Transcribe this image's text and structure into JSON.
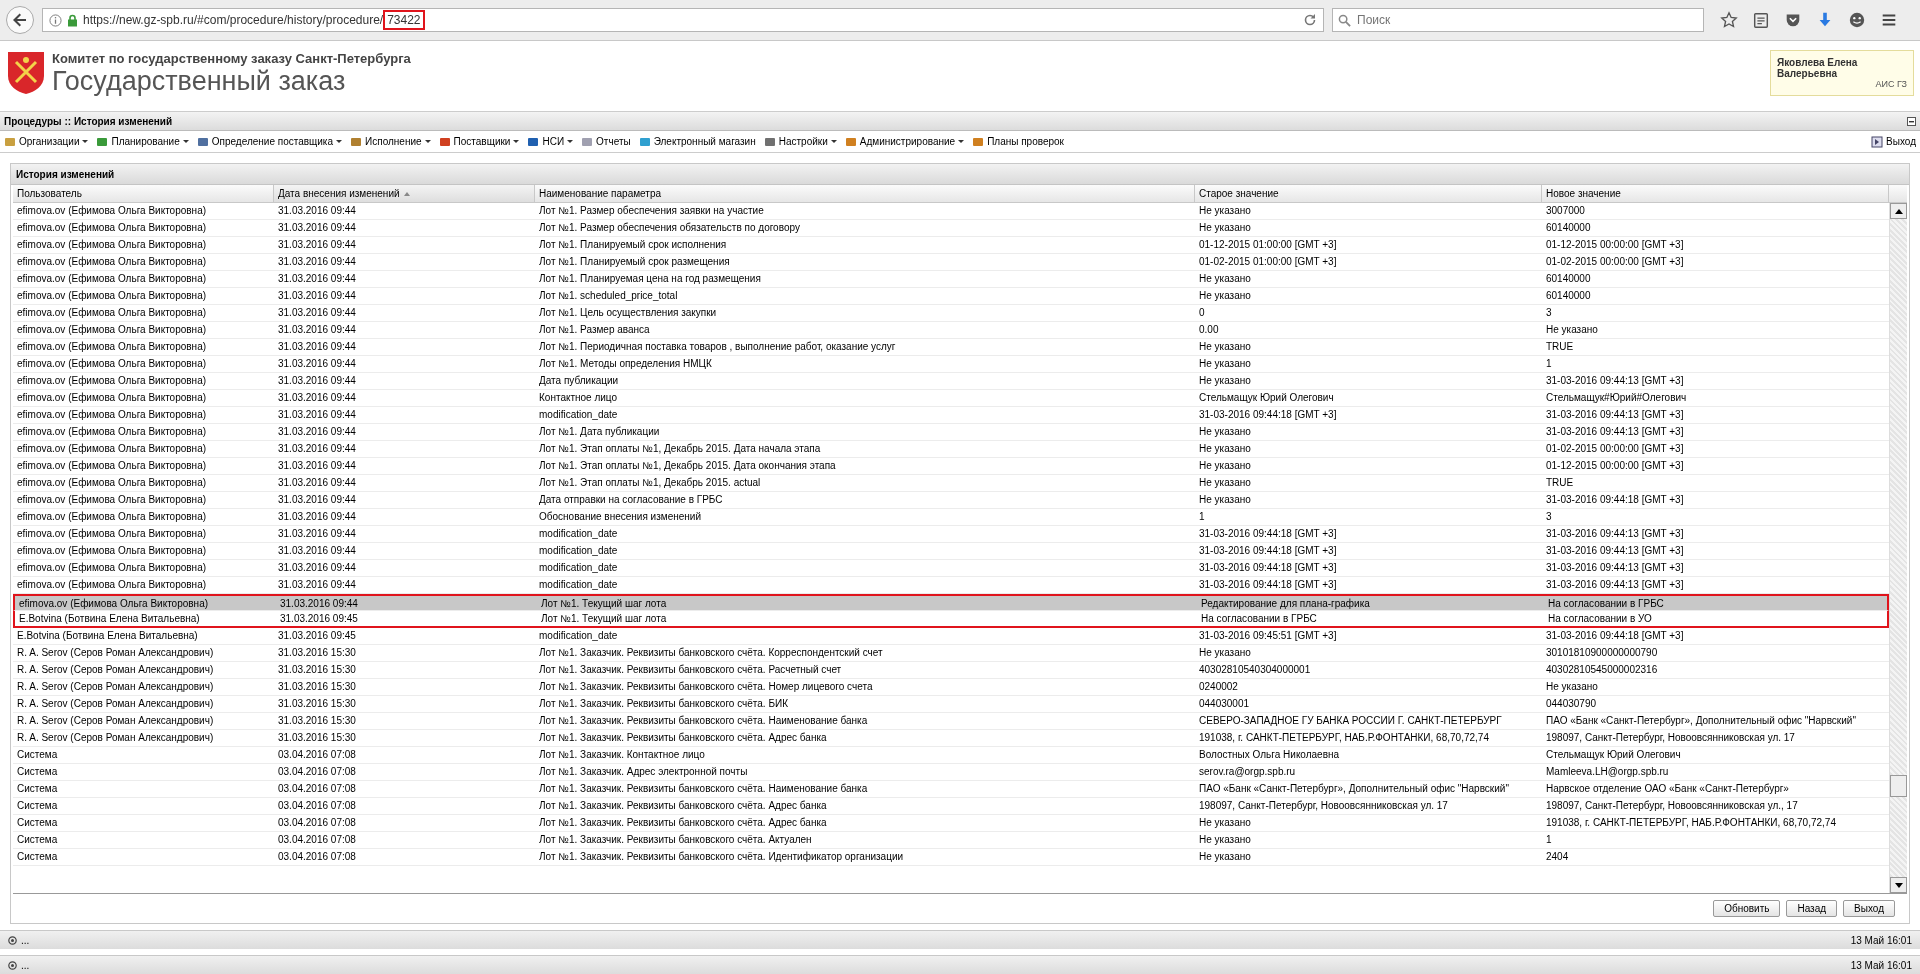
{
  "browser": {
    "url": "https://new.gz-spb.ru/#com/procedure/history/procedure/",
    "url_highlight": "73422",
    "search": {
      "placeholder": "Поиск"
    }
  },
  "header": {
    "org": "Комитет по государственному заказу Санкт-Петербурга",
    "title": "Государственный заказ",
    "user": {
      "name": "Яковлева Елена Валерьевна",
      "system": "АИС ГЗ"
    }
  },
  "breadcrumb": "Процедуры :: История изменений",
  "menu": [
    {
      "label": "Организации",
      "dropdown": true
    },
    {
      "label": "Планирование",
      "dropdown": true
    },
    {
      "label": "Определение поставщика",
      "dropdown": true
    },
    {
      "label": "Исполнение",
      "dropdown": true
    },
    {
      "label": "Поставщики",
      "dropdown": true
    },
    {
      "label": "НСИ",
      "dropdown": true
    },
    {
      "label": "Отчеты",
      "dropdown": false
    },
    {
      "label": "Электронный магазин",
      "dropdown": false
    },
    {
      "label": "Настройки",
      "dropdown": true
    },
    {
      "label": "Администрирование",
      "dropdown": true
    },
    {
      "label": "Планы проверок",
      "dropdown": false
    }
  ],
  "logout": "Выход",
  "panel": {
    "title": "История изменений",
    "columns": [
      {
        "label": "Пользователь",
        "sorted": false
      },
      {
        "label": "Дата внесения изменений",
        "sorted": true
      },
      {
        "label": "Наименование параметра",
        "sorted": false
      },
      {
        "label": "Старое значение",
        "sorted": false
      },
      {
        "label": "Новое значение",
        "sorted": false
      }
    ],
    "rows": [
      {
        "selected": false,
        "outlined": false,
        "cells": [
          "efimova.ov (Ефимова Ольга Викторовна)",
          "31.03.2016 09:44",
          "Лот №1. Размер обеспечения заявки на участие",
          "Не указано",
          "3007000"
        ]
      },
      {
        "selected": false,
        "outlined": false,
        "cells": [
          "efimova.ov (Ефимова Ольга Викторовна)",
          "31.03.2016 09:44",
          "Лот №1. Размер обеспечения обязательств по договору",
          "Не указано",
          "60140000"
        ]
      },
      {
        "selected": false,
        "outlined": false,
        "cells": [
          "efimova.ov (Ефимова Ольга Викторовна)",
          "31.03.2016 09:44",
          "Лот №1. Планируемый срок исполнения",
          "01-12-2015 01:00:00 [GMT +3]",
          "01-12-2015 00:00:00 [GMT +3]"
        ]
      },
      {
        "selected": false,
        "outlined": false,
        "cells": [
          "efimova.ov (Ефимова Ольга Викторовна)",
          "31.03.2016 09:44",
          "Лот №1. Планируемый срок размещения",
          "01-02-2015 01:00:00 [GMT +3]",
          "01-02-2015 00:00:00 [GMT +3]"
        ]
      },
      {
        "selected": false,
        "outlined": false,
        "cells": [
          "efimova.ov (Ефимова Ольга Викторовна)",
          "31.03.2016 09:44",
          "Лот №1. Планируемая цена на год размещения",
          "Не указано",
          "60140000"
        ]
      },
      {
        "selected": false,
        "outlined": false,
        "cells": [
          "efimova.ov (Ефимова Ольга Викторовна)",
          "31.03.2016 09:44",
          "Лот №1. scheduled_price_total",
          "Не указано",
          "60140000"
        ]
      },
      {
        "selected": false,
        "outlined": false,
        "cells": [
          "efimova.ov (Ефимова Ольга Викторовна)",
          "31.03.2016 09:44",
          "Лот №1. Цель осуществления закупки",
          "0",
          "3"
        ]
      },
      {
        "selected": false,
        "outlined": false,
        "cells": [
          "efimova.ov (Ефимова Ольга Викторовна)",
          "31.03.2016 09:44",
          "Лот №1. Размер аванса",
          "0.00",
          "Не указано"
        ]
      },
      {
        "selected": false,
        "outlined": false,
        "cells": [
          "efimova.ov (Ефимова Ольга Викторовна)",
          "31.03.2016 09:44",
          "Лот №1. Периодичная поставка товаров , выполнение работ, оказание услуг",
          "Не указано",
          "TRUE"
        ]
      },
      {
        "selected": false,
        "outlined": false,
        "cells": [
          "efimova.ov (Ефимова Ольга Викторовна)",
          "31.03.2016 09:44",
          "Лот №1. Методы определения НМЦК",
          "Не указано",
          "1"
        ]
      },
      {
        "selected": false,
        "outlined": false,
        "cells": [
          "efimova.ov (Ефимова Ольга Викторовна)",
          "31.03.2016 09:44",
          "Дата публикации",
          "Не указано",
          "31-03-2016 09:44:13 [GMT +3]"
        ]
      },
      {
        "selected": false,
        "outlined": false,
        "cells": [
          "efimova.ov (Ефимова Ольга Викторовна)",
          "31.03.2016 09:44",
          "Контактное лицо",
          "Стельмащук Юрий Олегович",
          "Стельмащук#Юрий#Олегович"
        ]
      },
      {
        "selected": false,
        "outlined": false,
        "cells": [
          "efimova.ov (Ефимова Ольга Викторовна)",
          "31.03.2016 09:44",
          "modification_date",
          "31-03-2016 09:44:18 [GMT +3]",
          "31-03-2016 09:44:13 [GMT +3]"
        ]
      },
      {
        "selected": false,
        "outlined": false,
        "cells": [
          "efimova.ov (Ефимова Ольга Викторовна)",
          "31.03.2016 09:44",
          "Лот №1. Дата публикации",
          "Не указано",
          "31-03-2016 09:44:13 [GMT +3]"
        ]
      },
      {
        "selected": false,
        "outlined": false,
        "cells": [
          "efimova.ov (Ефимова Ольга Викторовна)",
          "31.03.2016 09:44",
          "Лот №1. Этап оплаты №1, Декабрь 2015. Дата начала этапа",
          "Не указано",
          "01-02-2015 00:00:00 [GMT +3]"
        ]
      },
      {
        "selected": false,
        "outlined": false,
        "cells": [
          "efimova.ov (Ефимова Ольга Викторовна)",
          "31.03.2016 09:44",
          "Лот №1. Этап оплаты №1, Декабрь 2015. Дата окончания этапа",
          "Не указано",
          "01-12-2015 00:00:00 [GMT +3]"
        ]
      },
      {
        "selected": false,
        "outlined": false,
        "cells": [
          "efimova.ov (Ефимова Ольга Викторовна)",
          "31.03.2016 09:44",
          "Лот №1. Этап оплаты №1, Декабрь 2015. actual",
          "Не указано",
          "TRUE"
        ]
      },
      {
        "selected": false,
        "outlined": false,
        "cells": [
          "efimova.ov (Ефимова Ольга Викторовна)",
          "31.03.2016 09:44",
          "Дата отправки на согласование в ГРБС",
          "Не указано",
          "31-03-2016 09:44:18 [GMT +3]"
        ]
      },
      {
        "selected": false,
        "outlined": false,
        "cells": [
          "efimova.ov (Ефимова Ольга Викторовна)",
          "31.03.2016 09:44",
          "Обоснование внесения изменений",
          "1",
          "3"
        ]
      },
      {
        "selected": false,
        "outlined": false,
        "cells": [
          "efimova.ov (Ефимова Ольга Викторовна)",
          "31.03.2016 09:44",
          "modification_date",
          "31-03-2016 09:44:18 [GMT +3]",
          "31-03-2016 09:44:13 [GMT +3]"
        ]
      },
      {
        "selected": false,
        "outlined": false,
        "cells": [
          "efimova.ov (Ефимова Ольга Викторовна)",
          "31.03.2016 09:44",
          "modification_date",
          "31-03-2016 09:44:18 [GMT +3]",
          "31-03-2016 09:44:13 [GMT +3]"
        ]
      },
      {
        "selected": false,
        "outlined": false,
        "cells": [
          "efimova.ov (Ефимова Ольга Викторовна)",
          "31.03.2016 09:44",
          "modification_date",
          "31-03-2016 09:44:18 [GMT +3]",
          "31-03-2016 09:44:13 [GMT +3]"
        ]
      },
      {
        "selected": false,
        "outlined": false,
        "cells": [
          "efimova.ov (Ефимова Ольга Викторовна)",
          "31.03.2016 09:44",
          "modification_date",
          "31-03-2016 09:44:18 [GMT +3]",
          "31-03-2016 09:44:13 [GMT +3]"
        ]
      },
      {
        "selected": true,
        "outlined": true,
        "cells": [
          "efimova.ov (Ефимова Ольга Викторовна)",
          "31.03.2016 09:44",
          "Лот №1. Текущий шаг лота",
          "Редактирование для плана-графика",
          "На согласовании в ГРБС"
        ]
      },
      {
        "selected": false,
        "outlined": true,
        "cells": [
          "E.Botvina (Ботвина Елена Витальевна)",
          "31.03.2016 09:45",
          "Лот №1. Текущий шаг лота",
          "На согласовании в ГРБС",
          "На согласовании в УО"
        ]
      },
      {
        "selected": false,
        "outlined": false,
        "cells": [
          "E.Botvina (Ботвина Елена Витальевна)",
          "31.03.2016 09:45",
          "modification_date",
          "31-03-2016 09:45:51 [GMT +3]",
          "31-03-2016 09:44:18 [GMT +3]"
        ]
      },
      {
        "selected": false,
        "outlined": false,
        "cells": [
          "R. A. Serov (Серов Роман Александрович)",
          "31.03.2016 15:30",
          "Лот №1. Заказчик. Реквизиты банковского счёта. Корреспондентский счет",
          "Не указано",
          "30101810900000000790"
        ]
      },
      {
        "selected": false,
        "outlined": false,
        "cells": [
          "R. A. Serov (Серов Роман Александрович)",
          "31.03.2016 15:30",
          "Лот №1. Заказчик. Реквизиты банковского счёта. Расчетный счет",
          "40302810540304000001",
          "40302810545000002316"
        ]
      },
      {
        "selected": false,
        "outlined": false,
        "cells": [
          "R. A. Serov (Серов Роман Александрович)",
          "31.03.2016 15:30",
          "Лот №1. Заказчик. Реквизиты банковского счёта. Номер лицевого счета",
          "0240002",
          "Не указано"
        ]
      },
      {
        "selected": false,
        "outlined": false,
        "cells": [
          "R. A. Serov (Серов Роман Александрович)",
          "31.03.2016 15:30",
          "Лот №1. Заказчик. Реквизиты банковского счёта. БИК",
          "044030001",
          "044030790"
        ]
      },
      {
        "selected": false,
        "outlined": false,
        "cells": [
          "R. A. Serov (Серов Роман Александрович)",
          "31.03.2016 15:30",
          "Лот №1. Заказчик. Реквизиты банковского счёта. Наименование банка",
          "СЕВЕРО-ЗАПАДНОЕ ГУ БАНКА РОССИИ Г. САНКТ-ПЕТЕРБУРГ",
          "ПАО «Банк «Санкт-Петербург», Дополнительный офис \"Нарвский\""
        ]
      },
      {
        "selected": false,
        "outlined": false,
        "cells": [
          "R. A. Serov (Серов Роман Александрович)",
          "31.03.2016 15:30",
          "Лот №1. Заказчик. Реквизиты банковского счёта. Адрес банка",
          "191038, г. САНКТ-ПЕТЕРБУРГ, НАБ.Р.ФОНТАНКИ, 68,70,72,74",
          "198097, Санкт-Петербург, Новоовсянниковская ул. 17"
        ]
      },
      {
        "selected": false,
        "outlined": false,
        "cells": [
          "Система",
          "03.04.2016 07:08",
          "Лот №1. Заказчик. Контактное лицо",
          "Волостных Ольга Николаевна",
          "Стельмащук Юрий Олегович"
        ]
      },
      {
        "selected": false,
        "outlined": false,
        "cells": [
          "Система",
          "03.04.2016 07:08",
          "Лот №1. Заказчик. Адрес электронной почты",
          "serov.ra@orgp.spb.ru",
          "Mamleeva.LH@orgp.spb.ru"
        ]
      },
      {
        "selected": false,
        "outlined": false,
        "cells": [
          "Система",
          "03.04.2016 07:08",
          "Лот №1. Заказчик. Реквизиты банковского счёта. Наименование банка",
          "ПАО «Банк «Санкт-Петербург», Дополнительный офис \"Нарвский\"",
          "Нарвское отделение ОАО «Банк «Санкт-Петербург»"
        ]
      },
      {
        "selected": false,
        "outlined": false,
        "cells": [
          "Система",
          "03.04.2016 07:08",
          "Лот №1. Заказчик. Реквизиты банковского счёта. Адрес банка",
          "198097, Санкт-Петербург, Новоовсянниковская ул. 17",
          "198097, Санкт-Петербург, Новоовсянниковская ул., 17"
        ]
      },
      {
        "selected": false,
        "outlined": false,
        "cells": [
          "Система",
          "03.04.2016 07:08",
          "Лот №1. Заказчик. Реквизиты банковского счёта. Адрес банка",
          "Не указано",
          "191038, г. САНКТ-ПЕТЕРБУРГ, НАБ.Р.ФОНТАНКИ, 68,70,72,74"
        ]
      },
      {
        "selected": false,
        "outlined": false,
        "cells": [
          "Система",
          "03.04.2016 07:08",
          "Лот №1. Заказчик. Реквизиты банковского счёта. Актуален",
          "Не указано",
          "1"
        ]
      },
      {
        "selected": false,
        "outlined": false,
        "cells": [
          "Система",
          "03.04.2016 07:08",
          "Лот №1. Заказчик. Реквизиты банковского счёта. Идентификатор организации",
          "Не указано",
          "2404"
        ]
      }
    ],
    "buttons": [
      "Обновить",
      "Назад",
      "Выход"
    ]
  },
  "status_bars": [
    {
      "text": "...",
      "time": "13 Май 16:01"
    },
    {
      "text": "...",
      "time": "13 Май 16:01"
    }
  ]
}
